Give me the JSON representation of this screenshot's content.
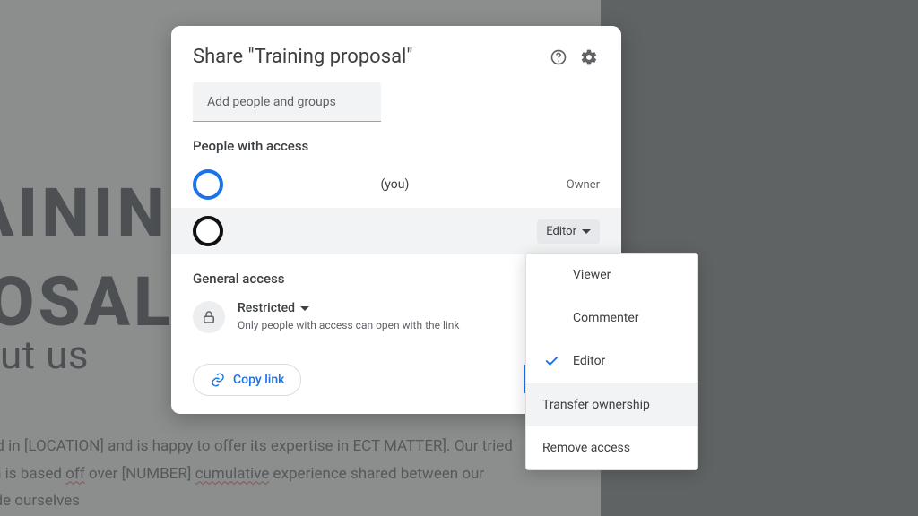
{
  "background_document": {
    "title_line1": "TRAINING",
    "title_line2": "PROPOSAL",
    "subheading": "About us",
    "body_text": "PANY] is located in [LOCATION] and is happy to offer its expertise in ECT MATTER]. Our tried and true system is based off over [NUMBER] cumulative experience shared between our trainers. We pride ourselves"
  },
  "dialog": {
    "title": "Share \"Training proposal\"",
    "add_placeholder": "Add people and groups",
    "sections": {
      "people_with_access": "People with access",
      "general_access": "General access"
    },
    "people": [
      {
        "label": "(you)",
        "role": "Owner"
      },
      {
        "label": "",
        "role": "Editor"
      }
    ],
    "general_access": {
      "label": "Restricted",
      "description": "Only people with access can open with the link"
    },
    "copy_link_label": "Copy link"
  },
  "role_menu": {
    "options": [
      "Viewer",
      "Commenter",
      "Editor"
    ],
    "selected": "Editor",
    "actions": [
      "Transfer ownership",
      "Remove access"
    ],
    "hovered": "Transfer ownership"
  }
}
